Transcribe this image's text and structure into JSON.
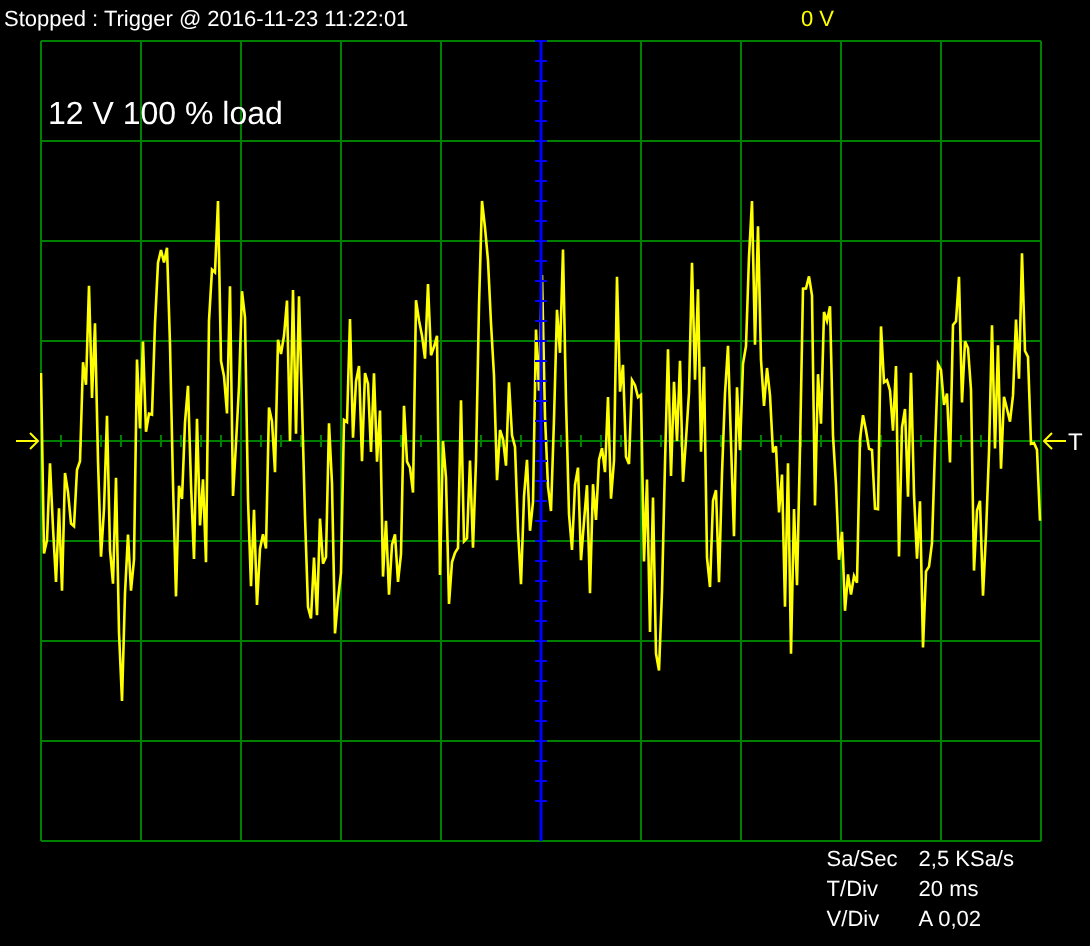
{
  "status": "Stopped : Trigger @ 2016-11-23 11:22:01",
  "trigger_level": "0 V",
  "plot": {
    "label": "12 V 100 % load"
  },
  "trigger_marker": "T",
  "readouts": [
    {
      "label": "Sa/Sec",
      "value": "2,5 KSa/s"
    },
    {
      "label": "T/Div",
      "value": "20 ms"
    },
    {
      "label": "V/Div",
      "value": "A 0,02"
    }
  ]
}
